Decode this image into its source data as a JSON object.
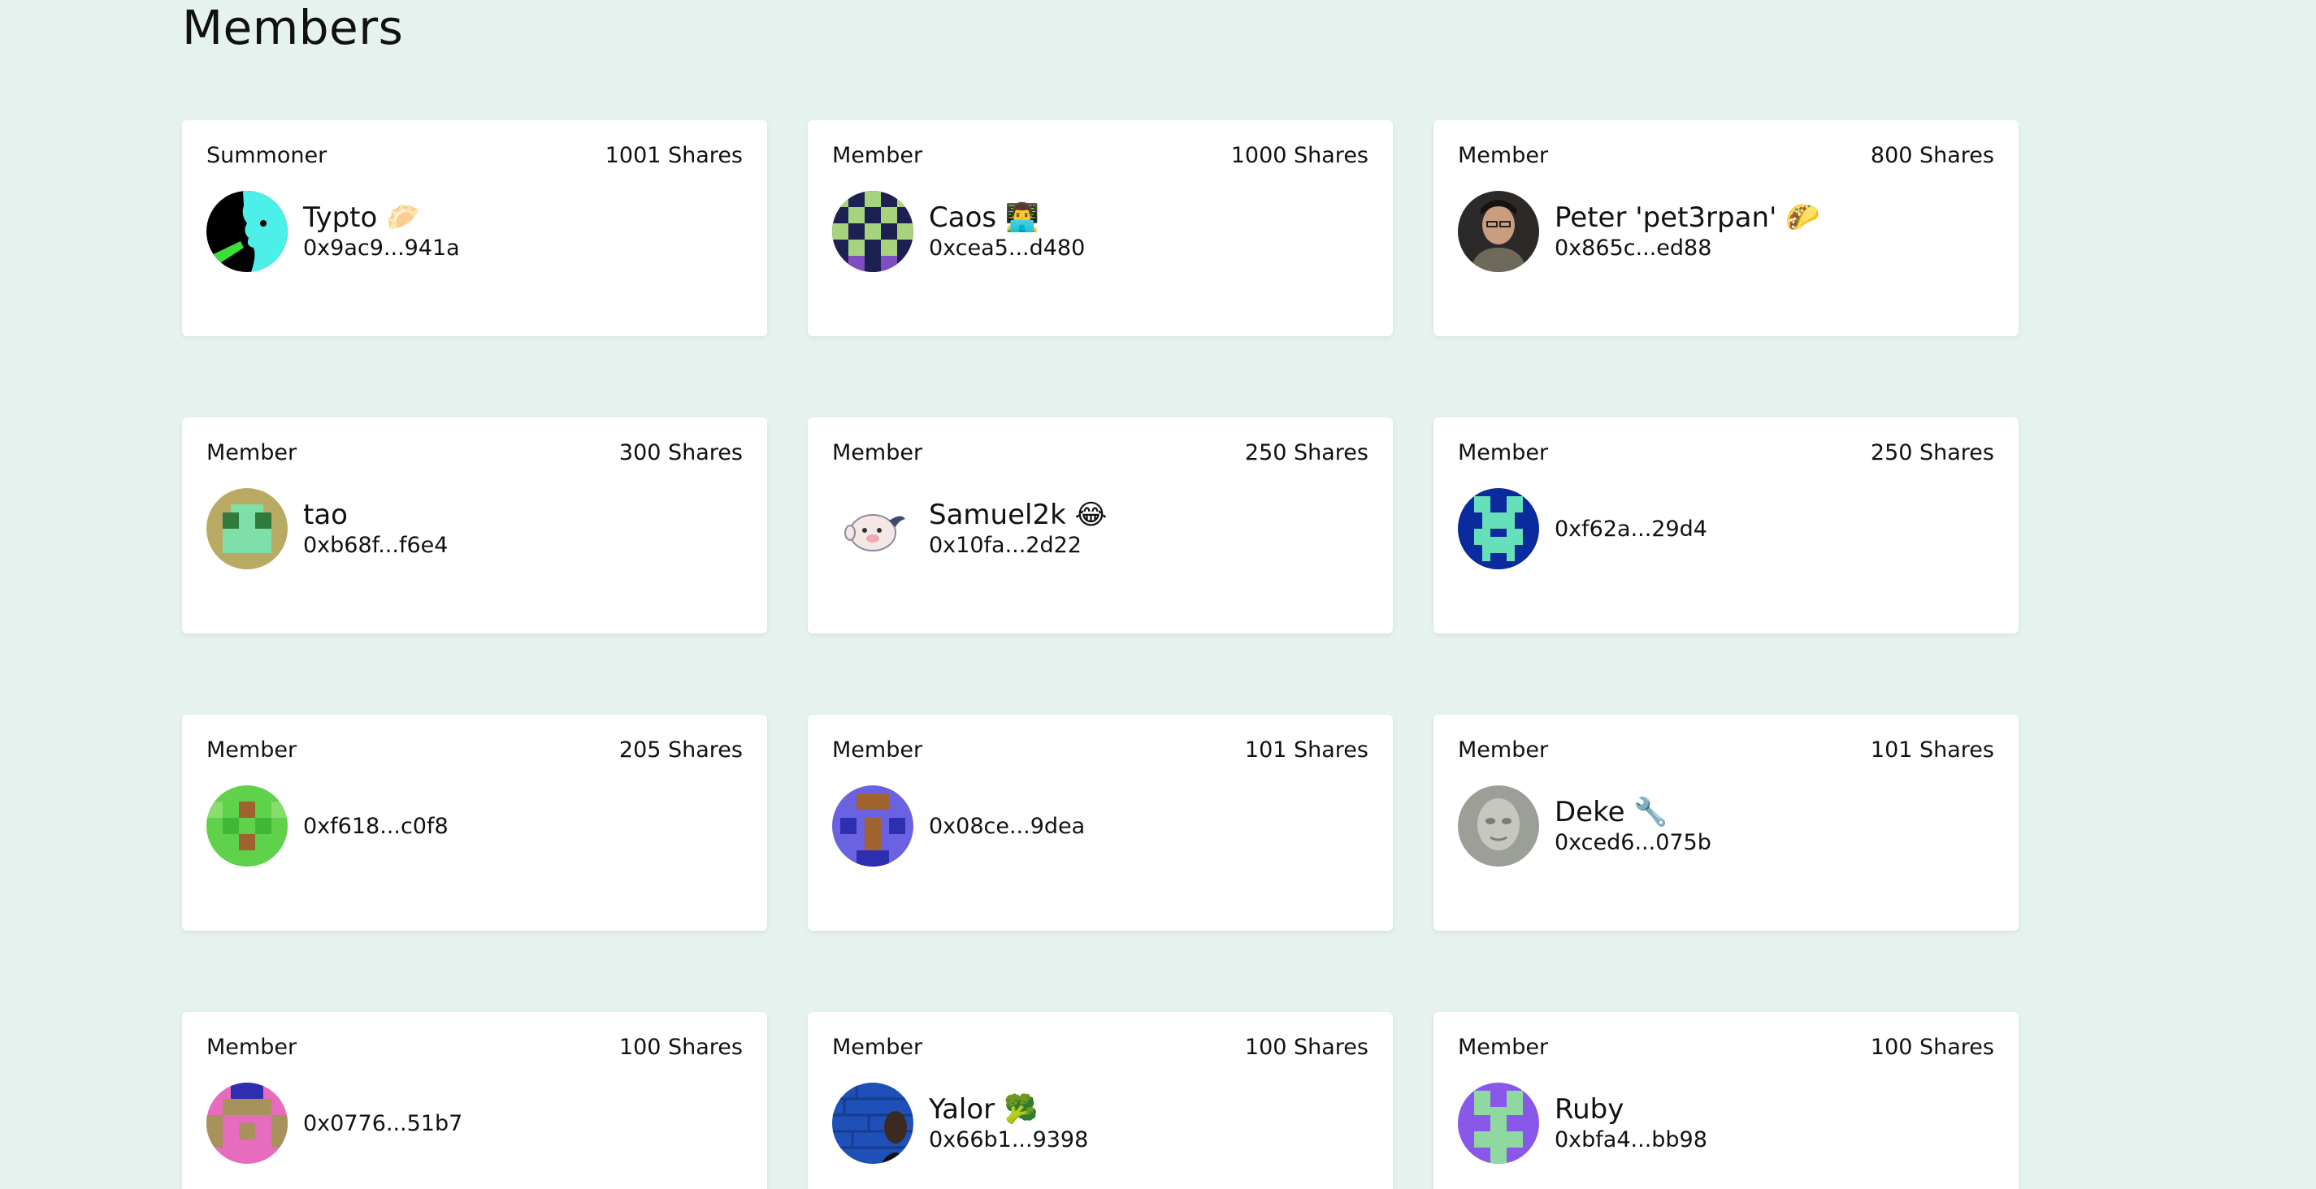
{
  "page": {
    "title": "Members"
  },
  "members": [
    {
      "role": "Summoner",
      "shares": "1001 Shares",
      "name": "Typto 🥟",
      "address": "0x9ac9...941a",
      "avatar": "portrait-cyan-green-icon"
    },
    {
      "role": "Member",
      "shares": "1000 Shares",
      "name": "Caos 👨‍💻",
      "address": "0xcea5...d480",
      "avatar": "checker-navy-green-icon"
    },
    {
      "role": "Member",
      "shares": "800 Shares",
      "name": "Peter 'pet3rpan' 🌮",
      "address": "0x865c...ed88",
      "avatar": "portrait-photo-icon"
    },
    {
      "role": "Member",
      "shares": "300 Shares",
      "name": "tao",
      "address": "0xb68f...f6e4",
      "avatar": "pixel-olive-mint-icon"
    },
    {
      "role": "Member",
      "shares": "250 Shares",
      "name": "Samuel2k 😂",
      "address": "0x10fa...2d22",
      "avatar": "cartoon-face-icon"
    },
    {
      "role": "Member",
      "shares": "250 Shares",
      "name": "",
      "address": "0xf62a...29d4",
      "avatar": "pixel-blue-mint-icon"
    },
    {
      "role": "Member",
      "shares": "205 Shares",
      "name": "",
      "address": "0xf618...c0f8",
      "avatar": "pixel-green-icon"
    },
    {
      "role": "Member",
      "shares": "101 Shares",
      "name": "",
      "address": "0x08ce...9dea",
      "avatar": "pixel-purple-brown-icon"
    },
    {
      "role": "Member",
      "shares": "101 Shares",
      "name": "Deke 🔧",
      "address": "0xced6...075b",
      "avatar": "statue-photo-icon"
    },
    {
      "role": "Member",
      "shares": "100 Shares",
      "name": "",
      "address": "0x0776...51b7",
      "avatar": "pixel-pink-olive-icon"
    },
    {
      "role": "Member",
      "shares": "100 Shares",
      "name": "Yalor 🥦",
      "address": "0x66b1...9398",
      "avatar": "blue-brick-photo-icon"
    },
    {
      "role": "Member",
      "shares": "100 Shares",
      "name": "Ruby",
      "address": "0xbfa4...bb98",
      "avatar": "pixel-purple-green-icon"
    }
  ],
  "colors": {
    "background": "#e5f2ee",
    "card": "#ffffff",
    "text": "#111111"
  }
}
